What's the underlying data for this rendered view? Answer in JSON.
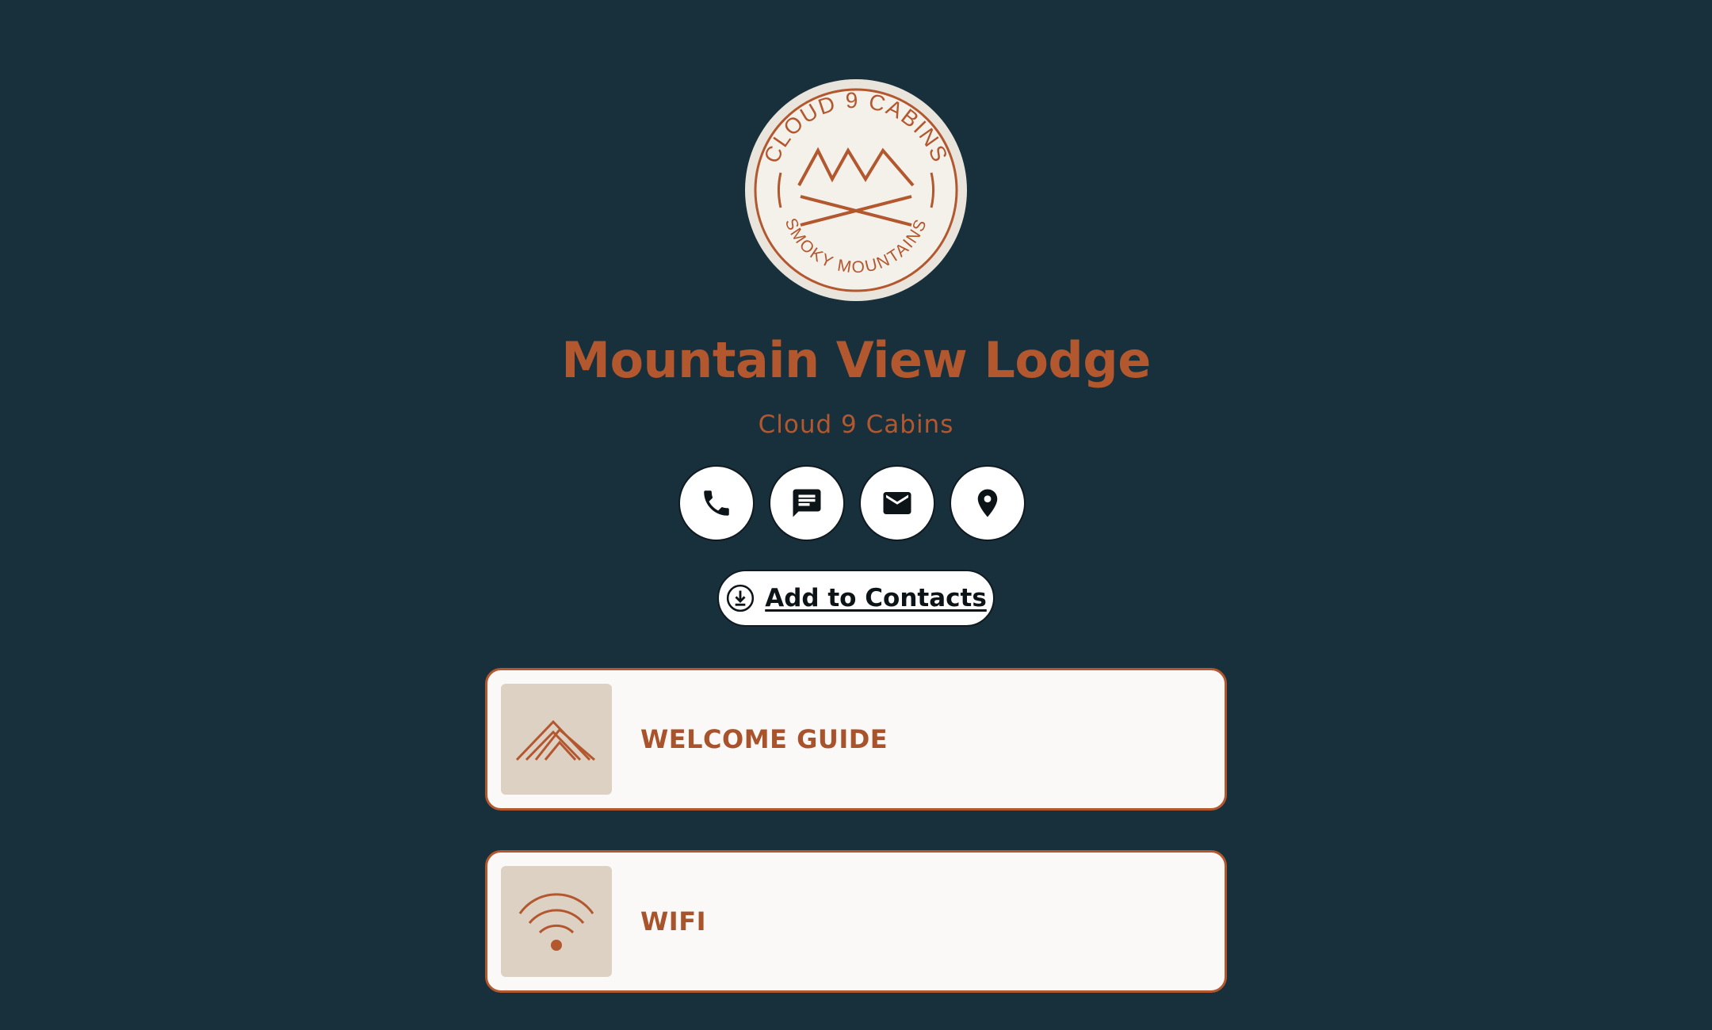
{
  "logo": {
    "top_text": "CLOUD 9 CABINS",
    "bottom_text": "SMOKY MOUNTAINS",
    "icon": "mountain-logo"
  },
  "profile": {
    "title": "Mountain View Lodge",
    "subtitle": "Cloud 9 Cabins"
  },
  "actions": [
    {
      "name": "call",
      "icon": "phone-icon"
    },
    {
      "name": "text",
      "icon": "message-icon"
    },
    {
      "name": "email",
      "icon": "mail-icon"
    },
    {
      "name": "location",
      "icon": "map-pin-icon"
    }
  ],
  "contacts_button": {
    "label": "Add to Contacts",
    "icon": "download-icon"
  },
  "links": [
    {
      "label": "WELCOME GUIDE",
      "icon": "mountain-lines-icon"
    },
    {
      "label": "WIFI",
      "icon": "wifi-icon"
    }
  ],
  "colors": {
    "background": "#18303c",
    "accent": "#b3572f",
    "card": "#fbf9f7",
    "thumb": "#ddd1c4"
  }
}
